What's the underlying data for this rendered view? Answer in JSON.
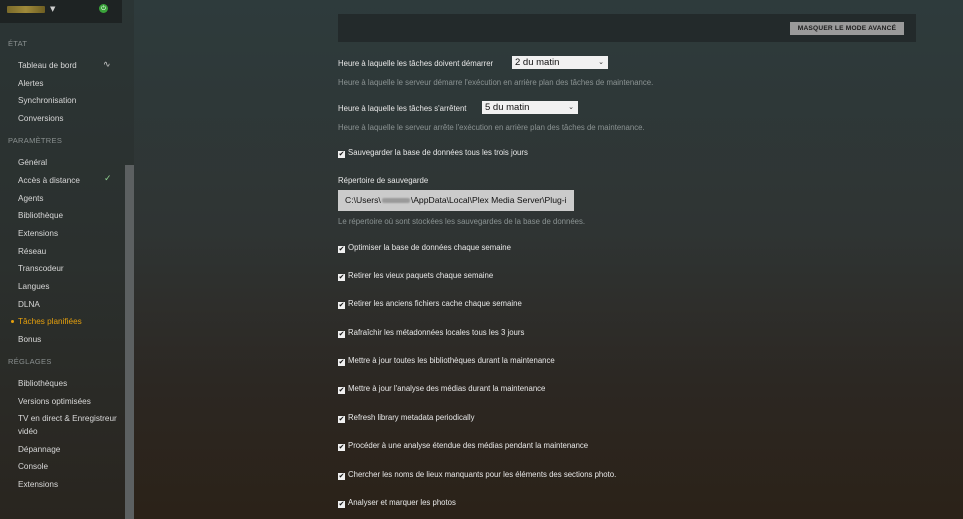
{
  "topbar": {
    "server_status_icon": "power-icon"
  },
  "sidebar": {
    "sections": [
      {
        "title": "ÉTAT",
        "items": [
          "Tableau de bord",
          "Alertes",
          "Synchronisation",
          "Conversions"
        ]
      },
      {
        "title": "PARAMÈTRES",
        "items": [
          "Général",
          "Accès à distance",
          "Agents",
          "Bibliothèque",
          "Extensions",
          "Réseau",
          "Transcodeur",
          "Langues",
          "DLNA",
          "Tâches planifiées",
          "Bonus"
        ]
      },
      {
        "title": "RÉGLAGES",
        "items": [
          "Bibliothèques",
          "Versions optimisées",
          "TV en direct & Enregistreur",
          "vidéo",
          "Dépannage",
          "Console",
          "Extensions"
        ]
      }
    ],
    "active_item": "Tâches planifiées",
    "accent_color": "#e5a00d"
  },
  "main": {
    "advanced_button": "MASQUER LE MODE AVANCÉ",
    "start_label": "Heure à laquelle les tâches doivent démarrer",
    "start_value": "2 du matin",
    "start_help": "Heure à laquelle le serveur démarre l'exécution en arrière plan des tâches de maintenance.",
    "stop_label": "Heure à laquelle les tâches s'arrêtent",
    "stop_value": "5 du matin",
    "stop_help": "Heure à laquelle le serveur arrête l'exécution en arrière plan des tâches de maintenance.",
    "backup_db": "Sauvegarder la base de données tous les trois jours",
    "backup_dir_label": "Répertoire de sauvegarde",
    "backup_dir_prefix": "C:\\Users\\",
    "backup_dir_suffix": "\\AppData\\Local\\Plex Media Server\\Plug-i",
    "backup_dir_help": "Le répertoire où sont stockées les sauvegardes de la base de données.",
    "tasks": [
      "Optimiser la base de données chaque semaine",
      "Retirer les vieux paquets chaque semaine",
      "Retirer les anciens fichiers cache chaque semaine",
      "Rafraîchir les métadonnées locales tous les 3 jours",
      "Mettre à jour toutes les bibliothèques durant la maintenance",
      "Mettre à jour l'analyse des médias durant la maintenance",
      "Refresh library metadata periodically",
      "Procéder à une analyse étendue des médias pendant la maintenance",
      "Chercher les noms de lieux manquants pour les éléments des sections photo.",
      "Analyser et marquer les photos"
    ]
  }
}
